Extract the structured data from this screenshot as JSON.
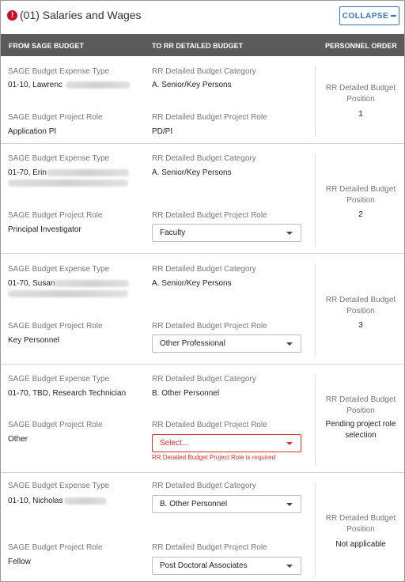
{
  "section": {
    "title": "(01) Salaries and Wages",
    "collapse_label": "COLLAPSE"
  },
  "columns": {
    "from": "FROM SAGE BUDGET",
    "to": "TO RR DETAILED BUDGET",
    "order": "PERSONNEL ORDER"
  },
  "labels": {
    "expense_type": "SAGE Budget Expense Type",
    "sage_role": "SAGE Budget Project Role",
    "rr_category": "RR Detailed Budget Category",
    "rr_role": "RR Detailed Budget Project Role",
    "position": "RR Detailed Budget Position"
  },
  "rows": [
    {
      "expense": "01-10, Lawrenc",
      "sage_role": "Application PI",
      "category": "A. Senior/Key Persons",
      "rr_role": "PD/PI",
      "position": "1"
    },
    {
      "expense": "01-70, Erin",
      "sage_role": "Principal Investigator",
      "category": "A. Senior/Key Persons",
      "rr_role": "Faculty",
      "position": "2"
    },
    {
      "expense": "01-70, Susan",
      "sage_role": "Key Personnel",
      "category": "A. Senior/Key Persons",
      "rr_role": "Other Professional",
      "position": "3"
    },
    {
      "expense": "01-70, TBD, Research Technician",
      "sage_role": "Other",
      "category": "B. Other Personnel",
      "rr_role": "Select...",
      "error": "RR Detailed Budget Project Role is required",
      "position": "Pending project role selection"
    },
    {
      "expense": "01-10, Nicholas",
      "sage_role": "Fellow",
      "category": "B. Other Personnel",
      "rr_role": "Post Doctoral Associates",
      "position": "Not applicable"
    }
  ],
  "colors": {
    "accent": "#3b73b9",
    "error": "#d9342b",
    "header_bg": "#5a5a5a"
  }
}
